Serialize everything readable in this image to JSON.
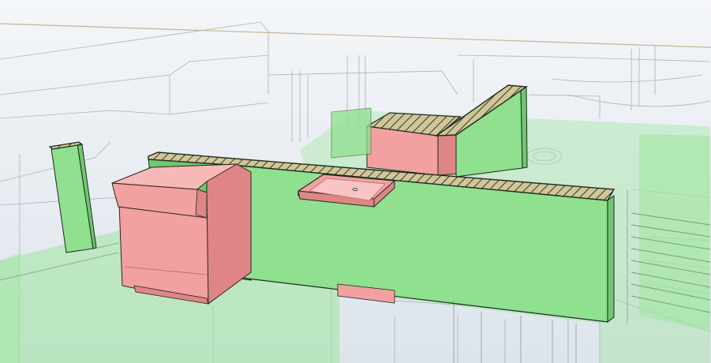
{
  "viewport": {
    "view_mode": "x-ray",
    "background_top": "#f4f6f8",
    "background_bottom": "#dde4ec"
  },
  "colors": {
    "section_green": "#8fe08f",
    "section_green_dark": "#6fc76f",
    "section_green_transparent": "#9ee59e",
    "highlight_pink": "#f2a0a0",
    "highlight_pink_dark": "#e08585",
    "hatch_fill": "#cfc79a",
    "hatch_line": "#3a3520",
    "edge_dark": "#1e2a1e",
    "ghost_line": "#9aa3ab",
    "horizon_line": "#b9a882"
  },
  "icons": {
    "cabinet": "cabinet-icon",
    "sink": "sink-icon"
  }
}
